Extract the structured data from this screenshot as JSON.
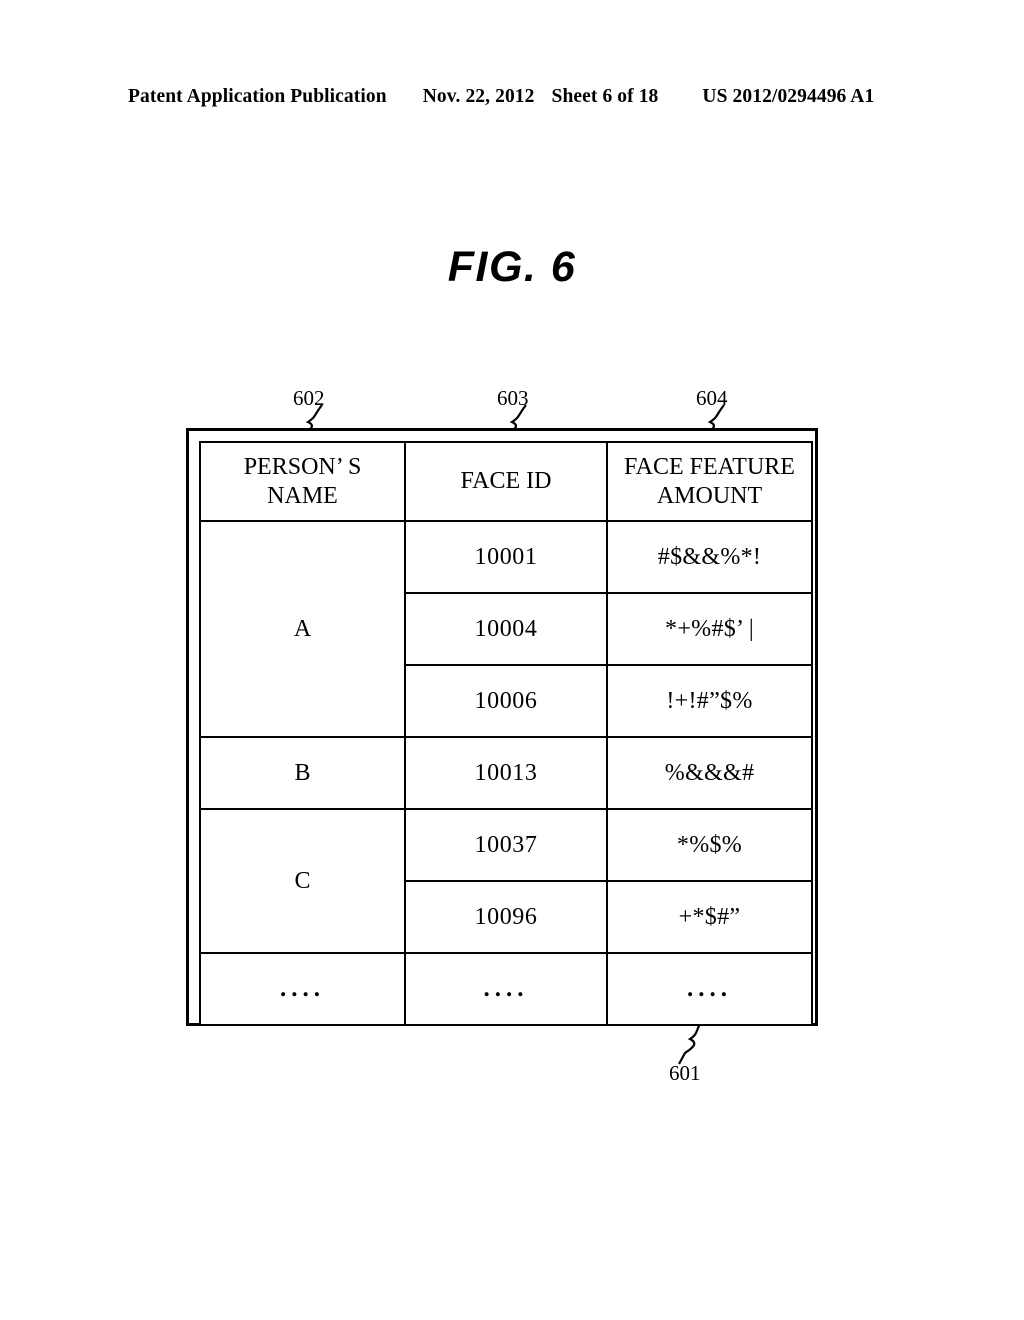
{
  "header": {
    "publication": "Patent Application Publication",
    "date": "Nov. 22, 2012",
    "sheet": "Sheet 6 of 18",
    "patent_number": "US 2012/0294496 A1"
  },
  "figure": {
    "title": "FIG. 6",
    "outer_box_ref": "601",
    "column_refs": {
      "name": "602",
      "face_id": "603",
      "feature": "604"
    }
  },
  "table": {
    "columns": [
      {
        "id": "name",
        "header_line1": "PERSON’ S",
        "header_line2": "NAME"
      },
      {
        "id": "face_id",
        "header_line1": "FACE ID",
        "header_line2": ""
      },
      {
        "id": "feature",
        "header_line1": "FACE FEATURE",
        "header_line2": "AMOUNT"
      }
    ],
    "groups": [
      {
        "name": "A",
        "rows": [
          {
            "face_id": "10001",
            "feature": "#$&&%*!"
          },
          {
            "face_id": "10004",
            "feature": "*+%#$’ |"
          },
          {
            "face_id": "10006",
            "feature": "!+!#”$%"
          }
        ]
      },
      {
        "name": "B",
        "rows": [
          {
            "face_id": "10013",
            "feature": "%&&&#"
          }
        ]
      },
      {
        "name": "C",
        "rows": [
          {
            "face_id": "10037",
            "feature": "*%$%"
          },
          {
            "face_id": "10096",
            "feature": "+*$#”"
          }
        ]
      },
      {
        "name": "....",
        "rows": [
          {
            "face_id": "....",
            "feature": "...."
          }
        ]
      }
    ]
  }
}
